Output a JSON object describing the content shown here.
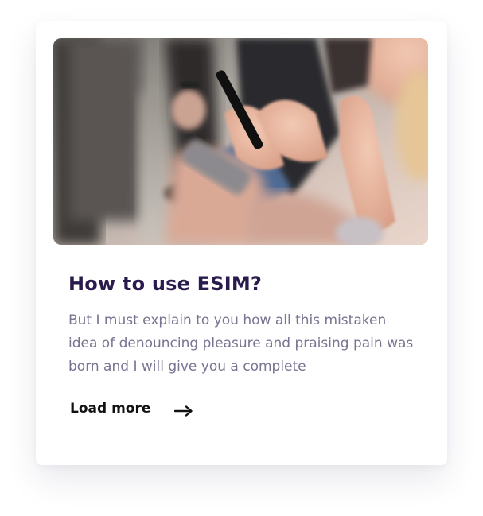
{
  "card": {
    "image_alt": "People using smartphones",
    "title": "How to use ESIM?",
    "excerpt": "But I must explain to you how all this mistaken idea of denouncing pleasure and praising pain was born and I will give you a complete",
    "load_more_label": "Load more",
    "arrow_icon": "arrow-right-icon"
  },
  "colors": {
    "title": "#2a1b4d",
    "excerpt": "#7a7391",
    "link": "#111111"
  }
}
